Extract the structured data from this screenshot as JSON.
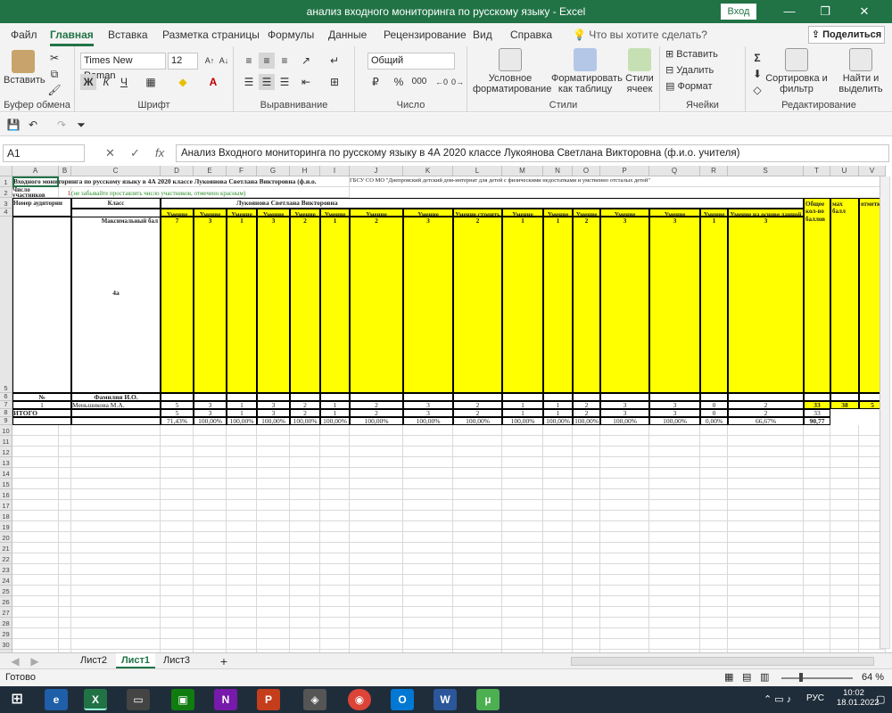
{
  "window": {
    "title": "анализ  входного мониторинга по русскому языку  -  Excel",
    "login": "Вход",
    "min": "—",
    "restore": "❐",
    "close": "✕"
  },
  "tabs": [
    "Файл",
    "Главная",
    "Вставка",
    "Разметка страницы",
    "Формулы",
    "Данные",
    "Рецензирование",
    "Вид",
    "Справка"
  ],
  "tell_me": "Что вы хотите сделать?",
  "share": "Поделиться",
  "ribbon": {
    "clipboard": {
      "label": "Буфер обмена",
      "paste": "Вставить"
    },
    "font": {
      "label": "Шрифт",
      "name": "Times New Roman",
      "size": "12",
      "bold": "Ж",
      "italic": "К",
      "underline": "Ч",
      "grow": "A↑",
      "shrink": "A↓"
    },
    "align": {
      "label": "Выравнивание"
    },
    "number": {
      "label": "Число",
      "format": "Общий",
      "percent": "%",
      "thousands": "000"
    },
    "styles": {
      "label": "Стили",
      "cond": "Условное форматирование",
      "table": "Форматировать как таблицу",
      "cell": "Стили ячеек"
    },
    "cells": {
      "label": "Ячейки",
      "insert": "Вставить",
      "delete": "Удалить",
      "format": "Формат"
    },
    "editing": {
      "label": "Редактирование",
      "sort": "Сортировка и фильтр",
      "find": "Найти и выделить"
    }
  },
  "formula_bar": {
    "name_box": "A1",
    "formula": "Анализ Входного мониторинга  по русскому языку в 4А  2020 классе Лукоянова Светлана Викторовна  (ф.и.о. учителя)"
  },
  "columns": [
    "A",
    "B",
    "C",
    "D",
    "E",
    "F",
    "G",
    "H",
    "I",
    "J",
    "K",
    "L",
    "M",
    "N",
    "O",
    "P",
    "Q",
    "R",
    "S",
    "T",
    "U",
    "V"
  ],
  "rows": {
    "header_rows": [
      "1",
      "2",
      "3",
      "4",
      "5",
      "6",
      "7",
      "8",
      "9"
    ],
    "empty_start": 10,
    "empty_end": 32
  },
  "sheet": {
    "r1_a": "Входного мониторинга  по русскому языку в 4А  2020 классе Лукоянова Светлана Викторовна  (ф.и.о.",
    "r1_j": "ГБСУ СО МО \"Днепровский детский дом-интернат для детей с физическими недостатками и умственно отсталых детей\"",
    "r2_a": "Число участников",
    "r2_b": "1",
    "r2_c": "(не забывайте проставлять число участников, отмечено красным)",
    "r3_a": "Номер аудитории",
    "r3_c": "Класс",
    "r3_d": "Лукоянова Светлана Викторовна",
    "r4_c": "4а",
    "skills": [
      "Умение писать текст под диктовку, соблюдая в практике письма изученные орфографические и пунктуационные нормы",
      "Умение распознавать однородные члены предложения",
      "Умение распознавать главные члены предложения",
      "Умение распознавать части речи",
      "Умение распознавать правильную орфоэпическую норму",
      "Умение классифицировать согласные звуки",
      "Умение распознавать основную мысль текста при его письменном предъявлении; адекватно формулировать основную мысль в письменной форме, соблюдая нормы построения предложения и словоупотребления",
      "Умение составлять план прочитанного текста (адекватно воспроизводить прочитанный текст с заданной степенью свернутости) в письменной форме, соблюдая нормы построения предложения",
      "Умение строить речевое высказывание заданной структуры (вопросительное предложение) в письменной форме по содержанию прочитанного текста",
      "Умение распознавать значение слова; адекватно формулировать значение слова в письменной форме, соблюдая нормы построения предложения и словоупотребления",
      "Умение подбирать к слову близкие по значению слова",
      "Умение классифицировать слова по составу",
      "Умение распознавать имена существительные в предложении, распознавать грамматические признаки имени существительного",
      "Умение распознавать имена прилагательные в предложении, распознавать грамматические признаки имени прилагательного",
      "Умение распознавать глаголы в предложении",
      "Умение на основе данной информации и собственного жизненного опыта обучающихся определять конкретную жизненную ситуацию для адекватной интерпретации данной информации, соблюдая при письме изученные орфографические и пунктуационные нормы"
    ],
    "r3_t": "Общее кол-во баллов",
    "r3_u": "мах балл",
    "r3_v": "отметка",
    "r5_c": "Максимальный  бал",
    "max_points": [
      "7",
      "3",
      "1",
      "3",
      "2",
      "1",
      "2",
      "3",
      "2",
      "1",
      "1",
      "2",
      "3",
      "3",
      "1",
      "3"
    ],
    "r6_a": "№",
    "r6_c": "Фамилия И.О.",
    "r7_a": "1",
    "r7_c": "Меньшикова М.А.",
    "r7_vals": [
      "5",
      "3",
      "1",
      "3",
      "2",
      "1",
      "2",
      "3",
      "2",
      "1",
      "1",
      "2",
      "3",
      "3",
      "0",
      "2"
    ],
    "r7_t": "33",
    "r7_u": "38",
    "r7_v": "5",
    "r8_a": "ИТОГО",
    "r8_vals": [
      "5",
      "3",
      "1",
      "3",
      "2",
      "1",
      "2",
      "3",
      "2",
      "1",
      "1",
      "2",
      "3",
      "3",
      "0",
      "2"
    ],
    "r8_t": "33",
    "r9_vals": [
      "71,43%",
      "100,00%",
      "100,00%",
      "100,00%",
      "100,00%",
      "100,00%",
      "100,00%",
      "100,00%",
      "100,00%",
      "100,00%",
      "100,00%",
      "100,00%",
      "100,00%",
      "100,00%",
      "0,00%",
      "66,67%"
    ],
    "r9_t": "90,77"
  },
  "sheet_tabs": [
    "Лист2",
    "Лист1",
    "Лист3"
  ],
  "add_sheet": "+",
  "status": {
    "ready": "Готово",
    "zoom": "64 %"
  },
  "taskbar": {
    "time": "10:02",
    "date": "18.01.2022",
    "lang": "РУС"
  }
}
